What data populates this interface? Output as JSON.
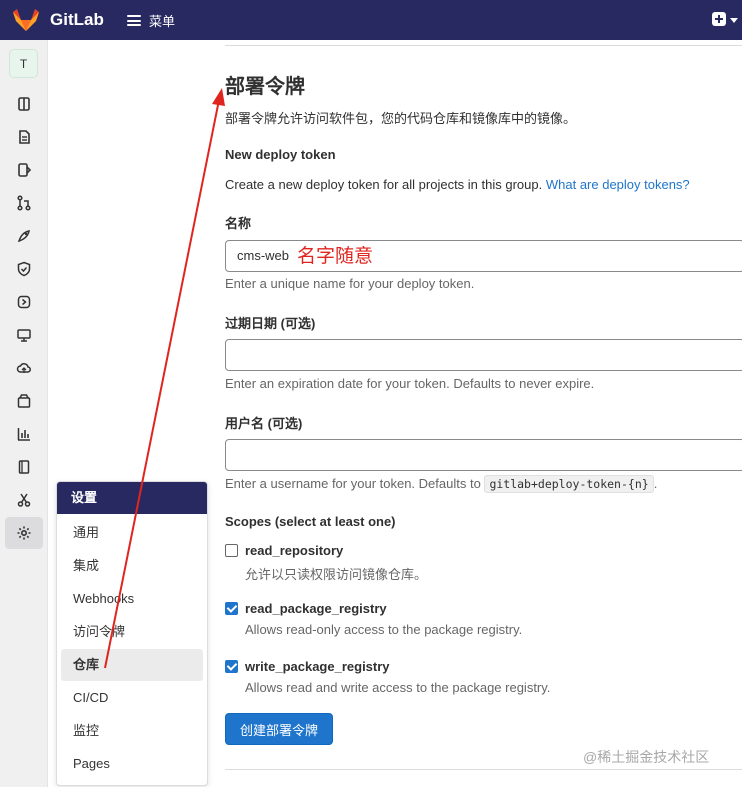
{
  "navbar": {
    "brand": "GitLab",
    "menu_label": "菜单",
    "bg_color": "#292961"
  },
  "sidebar": {
    "avatar_letter": "T",
    "icons": [
      "project-icon",
      "issues-icon",
      "merge-request-icon",
      "branch-icon",
      "rocket-icon",
      "shield-icon",
      "deploy-icon",
      "monitor-icon",
      "cloud-icon",
      "package-icon",
      "analytics-icon",
      "wiki-icon",
      "snippets-icon",
      "settings-icon"
    ]
  },
  "flyout": {
    "title": "设置",
    "items": [
      "通用",
      "集成",
      "Webhooks",
      "访问令牌",
      "仓库",
      "CI/CD",
      "监控",
      "Pages"
    ],
    "active": "仓库"
  },
  "main": {
    "title": "部署令牌",
    "description": "部署令牌允许访问软件包，您的代码仓库和镜像库中的镜像。",
    "section_title": "New deploy token",
    "section_desc": "Create a new deploy token for all projects in this group.",
    "section_link": "What are deploy tokens?",
    "name_label": "名称",
    "name_value": "cms-web",
    "name_annotation": "名字随意",
    "name_help": "Enter a unique name for your deploy token.",
    "expiry_label": "过期日期 (可选)",
    "expiry_help": "Enter an expiration date for your token. Defaults to never expire.",
    "username_label": "用户名 (可选)",
    "username_help_prefix": "Enter a username for your token. Defaults to",
    "username_default": "gitlab+deploy-token-{n}",
    "username_help_suffix": ".",
    "scopes_label": "Scopes (select at least one)",
    "scopes": [
      {
        "name": "read_repository",
        "help": "允许以只读权限访问镜像仓库。",
        "checked": false
      },
      {
        "name": "read_package_registry",
        "help": "Allows read-only access to the package registry.",
        "checked": true
      },
      {
        "name": "write_package_registry",
        "help": "Allows read and write access to the package registry.",
        "checked": true
      }
    ],
    "create_button": "创建部署令牌"
  },
  "watermark": "@稀土掘金技术社区",
  "accent_color": "#1f75cb",
  "annotation_color": "#e0251f"
}
